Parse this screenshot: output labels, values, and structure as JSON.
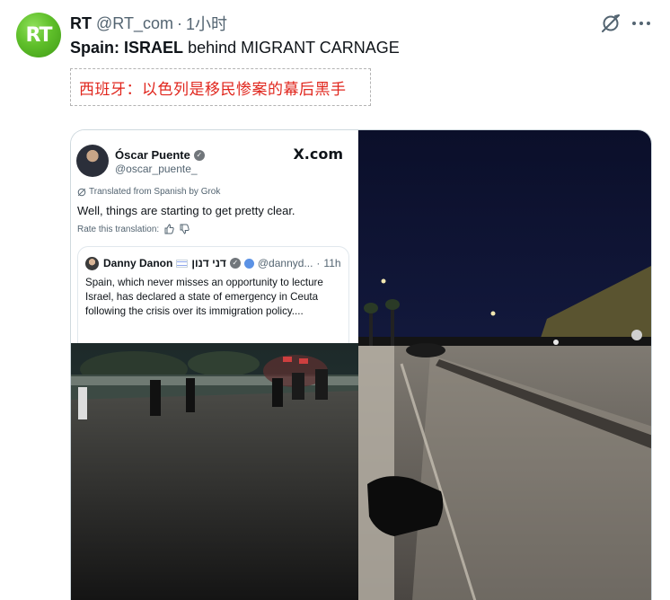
{
  "post": {
    "author": {
      "avatar_text": "RT",
      "name": "RT",
      "handle": "@RT_com",
      "separator": "·",
      "time": "1小时"
    },
    "headline_bold_1": "Spain:",
    "headline_bold_2": "ISRAEL",
    "headline_rest": "behind MIGRANT CARNAGE",
    "translation": "西班牙：以色列是移民惨案的幕后黑手"
  },
  "icons": {
    "grok": "grok-icon",
    "more": "more-icon",
    "verified": "verified-icon",
    "translate": "translate-icon",
    "thumbs_up": "thumbs-up-icon",
    "thumbs_down": "thumbs-down-icon"
  },
  "media": {
    "embedded_tweet": {
      "name": "Óscar Puente",
      "handle": "@oscar_puente_",
      "source": "X.com",
      "translated_note": "Translated from Spanish by Grok",
      "text": "Well, things are starting to get pretty clear.",
      "rate_label": "Rate this translation:",
      "quote": {
        "name": "Danny Danon",
        "hebrew_name": "דני דנון",
        "handle": "@dannyd...",
        "separator": "·",
        "time": "11h",
        "text": "Spain, which never misses an opportunity to lecture Israel, has declared a state of emergency in Ceuta following the crisis over its immigration policy...."
      }
    }
  },
  "colors": {
    "accent_text": "#0f1419",
    "secondary_text": "#536471",
    "translation_red": "#e0261d",
    "rt_green": "#5fbf2a",
    "night_sky": "#0d1230"
  }
}
